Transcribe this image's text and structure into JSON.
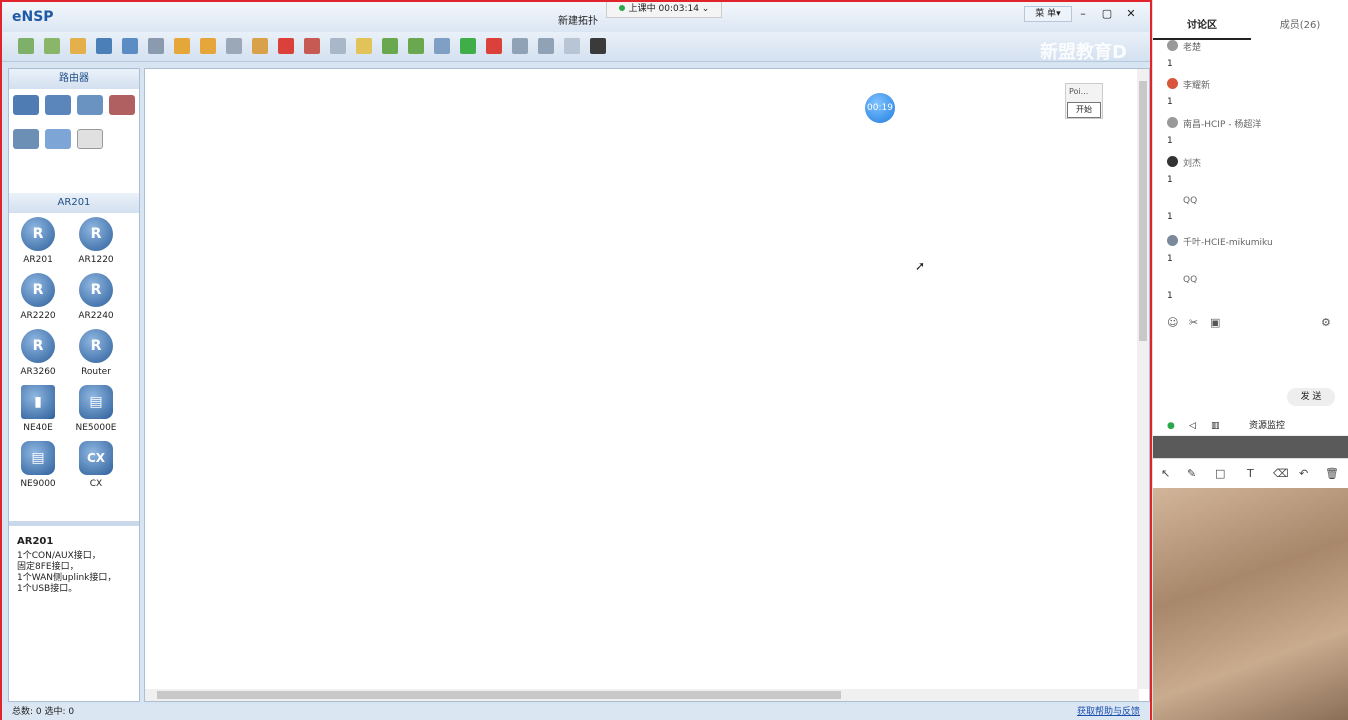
{
  "app": {
    "logo": "eNSP",
    "title": "新建拓扑",
    "menu_label": "菜 单▾"
  },
  "live": {
    "status": "上课中 00:03:14 ⌄"
  },
  "window_controls": {
    "minimize": "–",
    "maximize": "▢",
    "close": "✕"
  },
  "watermark": "新盟教育D",
  "panel": {
    "section1_title": "路由器",
    "section2_title": "AR201",
    "devices": [
      {
        "label": "AR201",
        "glyph": "R"
      },
      {
        "label": "AR1220",
        "glyph": "R"
      },
      {
        "label": "AR2220",
        "glyph": "R"
      },
      {
        "label": "AR2240",
        "glyph": "R"
      },
      {
        "label": "AR3260",
        "glyph": "R"
      },
      {
        "label": "Router",
        "glyph": "R"
      },
      {
        "label": "NE40E",
        "glyph": "▮"
      },
      {
        "label": "NE5000E",
        "glyph": "▤"
      },
      {
        "label": "NE9000",
        "glyph": "▤"
      },
      {
        "label": "CX",
        "glyph": "CX"
      }
    ],
    "info_title": "AR201",
    "info_desc": [
      "1个CON/AUX接口，",
      "固定8FE接口，",
      "1个WAN侧uplink接口，",
      "1个USB接口。"
    ]
  },
  "canvas": {
    "timer": "00:19",
    "popup_title": "Poi...",
    "popup_button": "开始"
  },
  "status": {
    "left": "总数: 0  选中: 0",
    "right": "获取帮助与反馈"
  },
  "side": {
    "tab_discuss": "讨论区",
    "tab_members": "成员(26)",
    "messages": [
      {
        "name": "老楚",
        "content": "1"
      },
      {
        "name": "李耀新",
        "content": "1"
      },
      {
        "name": "南昌-HCIP - 杨超洋",
        "content": "1"
      },
      {
        "name": "刘杰",
        "content": "1"
      },
      {
        "name": "QQ",
        "content": "1"
      },
      {
        "name": "千叶-HCIE-mikumiku",
        "content": "1"
      },
      {
        "name": "QQ",
        "content": "1"
      }
    ],
    "send_label": "发 送",
    "resource_label": "资源监控"
  }
}
